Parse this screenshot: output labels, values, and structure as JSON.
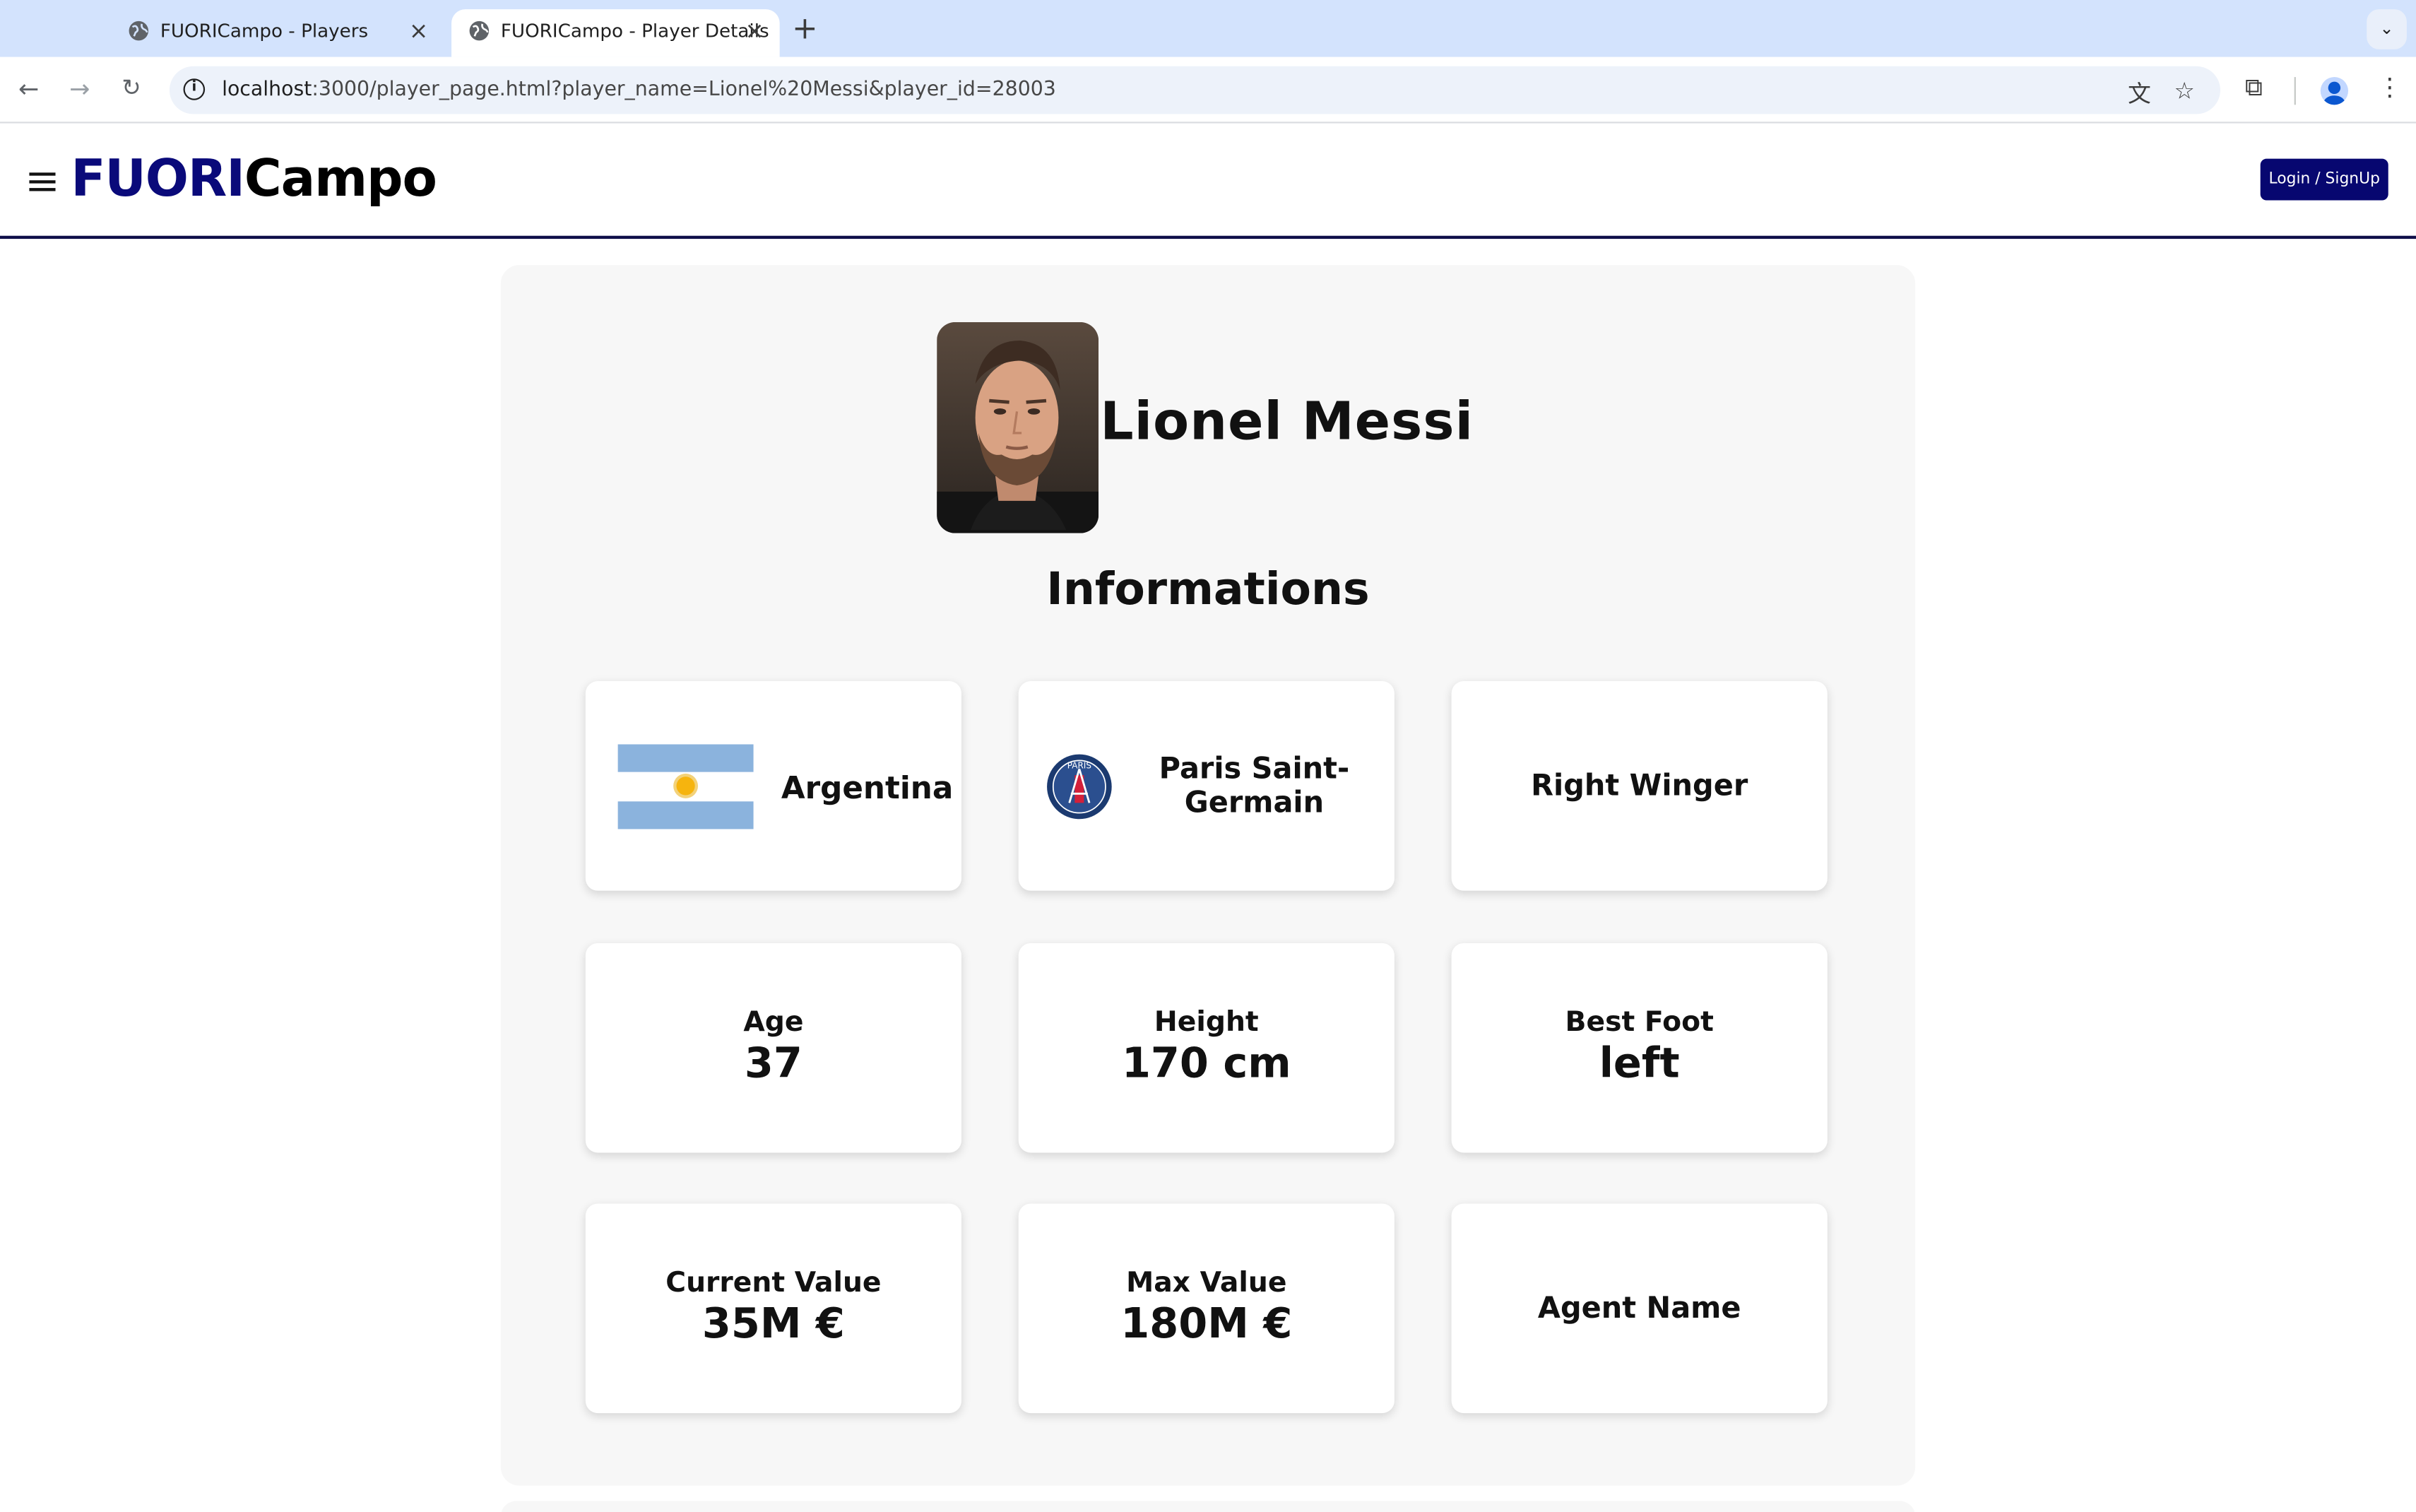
{
  "browser": {
    "tabs": [
      {
        "title": "FUORICampo - Players",
        "active": false
      },
      {
        "title": "FUORICampo - Player Details",
        "active": true
      }
    ],
    "url_host": "localhost",
    "url_rest": ":3000/player_page.html?player_name=Lionel%20Messi&player_id=28003"
  },
  "header": {
    "logo_part1": "FUORI",
    "logo_part2": "Campo",
    "login_label": "Login / SignUp",
    "accent_color": "#070770"
  },
  "player": {
    "name": "Lionel Messi",
    "section_title": "Informations",
    "nationality": "Argentina",
    "club": "Paris Saint-Germain",
    "position": "Right Winger",
    "stats": [
      {
        "label": "Age",
        "value": "37"
      },
      {
        "label": "Height",
        "value": "170 cm"
      },
      {
        "label": "Best Foot",
        "value": "left"
      },
      {
        "label": "Current Value",
        "value": "35M €"
      },
      {
        "label": "Max Value",
        "value": "180M €"
      },
      {
        "label": "Agent Name",
        "value": ""
      }
    ]
  }
}
